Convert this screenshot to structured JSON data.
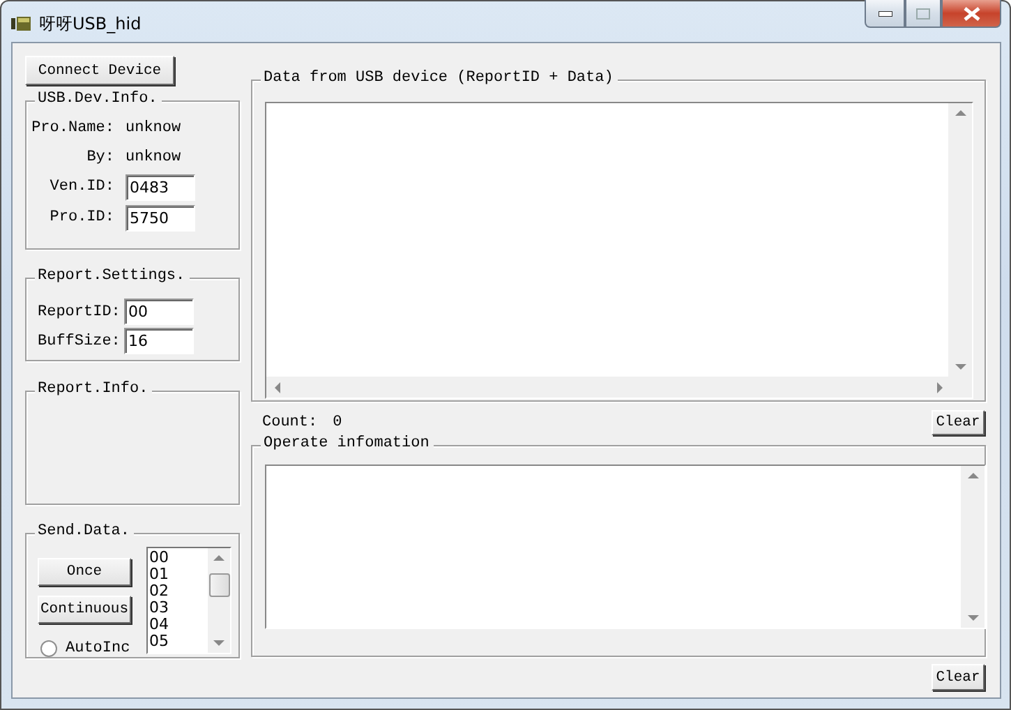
{
  "window": {
    "title": "呀呀USB_hid"
  },
  "connect_button": "Connect Device",
  "device_info": {
    "title": "USB.Dev.Info.",
    "fields": [
      {
        "kind": "text",
        "label": "Pro.Name:",
        "value": "unknow"
      },
      {
        "kind": "text",
        "label": "By:",
        "value": "unknow"
      },
      {
        "kind": "input",
        "label": "Ven.ID:",
        "value": "0483"
      },
      {
        "kind": "input",
        "label": "Pro.ID:",
        "value": "5750"
      }
    ]
  },
  "report_settings": {
    "title": "Report.Settings.",
    "fields": [
      {
        "label": "ReportID:",
        "value": "00"
      },
      {
        "label": "BuffSize:",
        "value": "16"
      }
    ]
  },
  "report_info": {
    "title": "Report.Info."
  },
  "send_data": {
    "title": "Send.Data.",
    "buttons": [
      "Once",
      "Continuous"
    ],
    "autoinc": {
      "label": "AutoInc",
      "checked": false
    },
    "list": [
      "00",
      "01",
      "02",
      "03",
      "04",
      "05"
    ]
  },
  "data_panel": {
    "title": "Data from USB device (ReportID + Data)",
    "count_label": "Count:",
    "count": "0",
    "clear": "Clear"
  },
  "operate_panel": {
    "title": "Operate infomation",
    "clear": "Clear"
  }
}
